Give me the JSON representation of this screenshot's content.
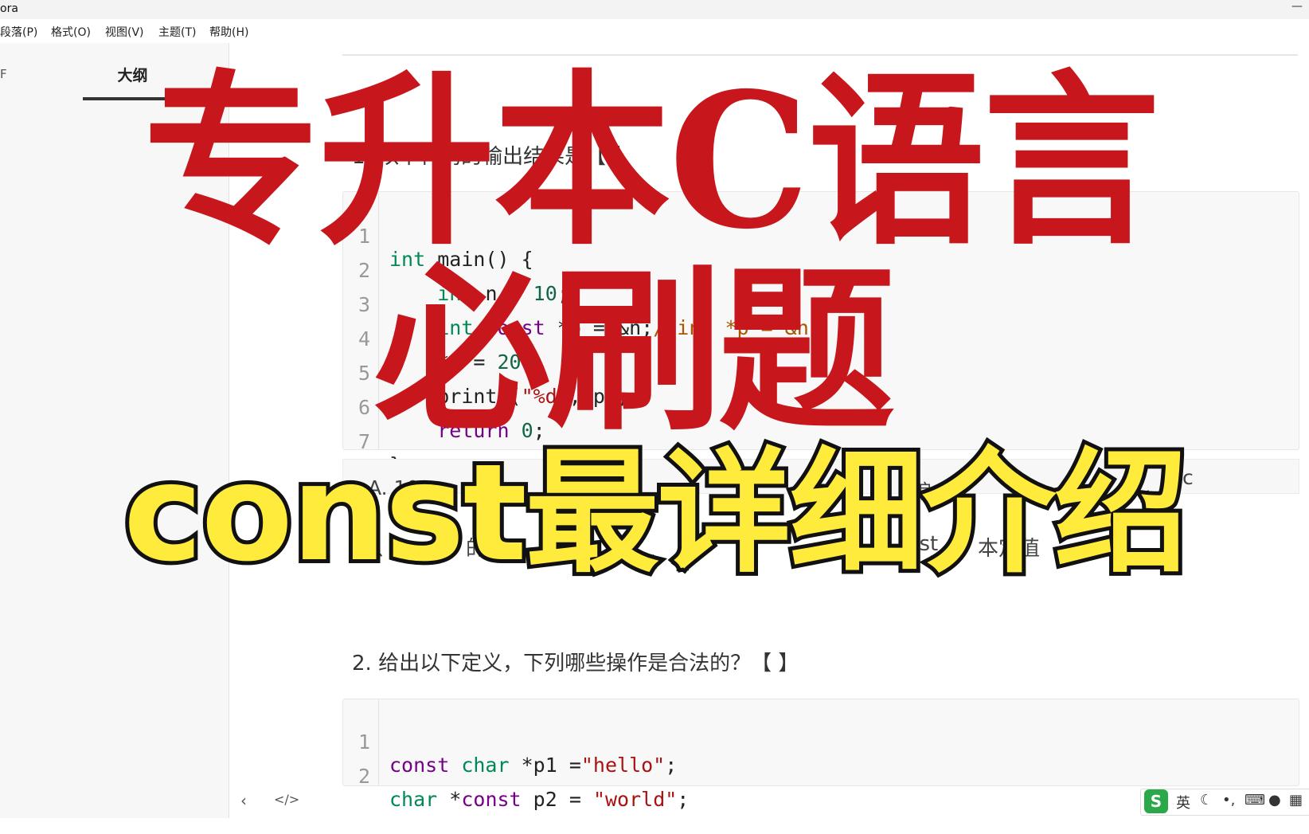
{
  "window": {
    "title": "ora",
    "minimize_glyph": "—"
  },
  "menubar": {
    "items": [
      "段落(P)",
      "格式(O)",
      "视图(V)",
      "主题(T)",
      "帮助(H)"
    ]
  },
  "sidebar": {
    "tab_files": "F",
    "tab_outline": "大纲",
    "back_glyph": "‹",
    "source_glyph": "</>"
  },
  "content": {
    "q1": "1. 以下代码的输出结果是【    】",
    "code1": [
      {
        "n": "1",
        "text": "int main() {"
      },
      {
        "n": "2",
        "text": "    int n = 10;"
      },
      {
        "n": "3",
        "text": "    int const *p = &n;//int *p = &n;"
      },
      {
        "n": "4",
        "text": "    *p = 20;"
      },
      {
        "n": "5",
        "text": "    printf(\"%d\",*p);"
      },
      {
        "n": "6",
        "text": "    return 0;"
      },
      {
        "n": "7",
        "text": "}"
      }
    ],
    "options_visible": "A.  10",
    "options_tail": "c",
    "options_mid": "编",
    "hint_left": "以",
    "hint_mid": "的",
    "hint_right": "nst",
    "hint_far": "本定值",
    "q2": "2. 给出以下定义，下列哪些操作是合法的？【    】",
    "code2": [
      {
        "n": "1",
        "text": "const char *p1 =\"hello\";"
      },
      {
        "n": "2",
        "text": "char *const p2 = \"world\";"
      }
    ]
  },
  "overlay": {
    "red_line1": "专升本C语言",
    "red_line2": "必刷题",
    "yellow_line": "const最详细介绍"
  },
  "ime": {
    "logo": "S",
    "mode": "英",
    "icons": [
      "moon-icon",
      "punct-icon",
      "keyboard-icon",
      "user-icon",
      "grid-icon"
    ]
  }
}
